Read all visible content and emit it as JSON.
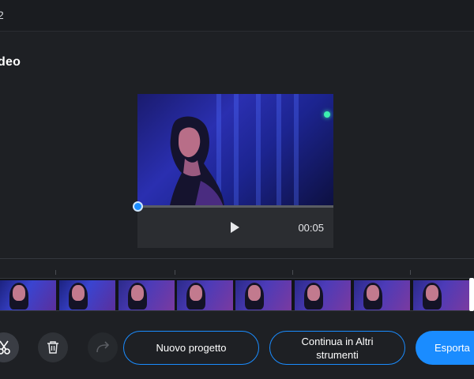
{
  "topbar": {
    "crumb": "2"
  },
  "page": {
    "title": "deo"
  },
  "player": {
    "time": "00:05",
    "play_icon": "play-icon"
  },
  "timeline": {
    "frames": 8
  },
  "toolbar": {
    "cut_icon": "scissors-icon",
    "delete_icon": "trash-icon",
    "redo_icon": "redo-icon",
    "new_project_label": "Nuovo progetto",
    "continue_label": "Continua in Altri strumenti",
    "export_label": "Esporta"
  },
  "colors": {
    "background": "#1e2024",
    "accent": "#1a8cff",
    "panel": "#2b2d31"
  }
}
